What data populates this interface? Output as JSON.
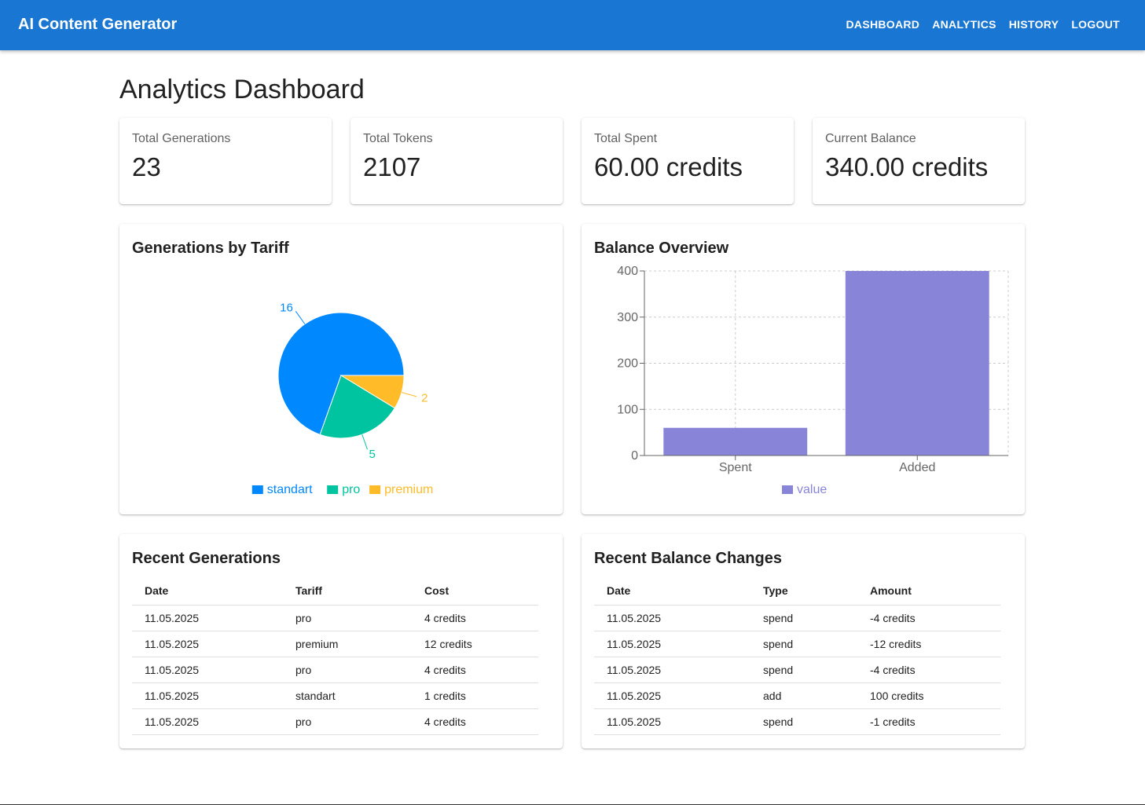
{
  "app": {
    "title": "AI Content Generator",
    "nav": [
      "DASHBOARD",
      "ANALYTICS",
      "HISTORY",
      "LOGOUT"
    ]
  },
  "page": {
    "title": "Analytics Dashboard"
  },
  "stats": [
    {
      "label": "Total Generations",
      "value": "23"
    },
    {
      "label": "Total Tokens",
      "value": "2107"
    },
    {
      "label": "Total Spent",
      "value": "60.00 credits"
    },
    {
      "label": "Current Balance",
      "value": "340.00 credits"
    }
  ],
  "pie_card": {
    "title": "Generations by Tariff"
  },
  "bar_card": {
    "title": "Balance Overview"
  },
  "chart_data": [
    {
      "type": "pie",
      "title": "Generations by Tariff",
      "categories": [
        "standart",
        "pro",
        "premium"
      ],
      "values": [
        16,
        5,
        2
      ],
      "colors": [
        "#0088fe",
        "#00c49f",
        "#ffbb28"
      ],
      "legend": "bottom"
    },
    {
      "type": "bar",
      "title": "Balance Overview",
      "categories": [
        "Spent",
        "Added"
      ],
      "series": [
        {
          "name": "value",
          "values": [
            60,
            400
          ]
        }
      ],
      "ylim": [
        0,
        400
      ],
      "yticks": [
        "0",
        "100",
        "200",
        "300",
        "400"
      ],
      "grid": true,
      "color": "#8884d8",
      "legend": "bottom"
    }
  ],
  "recent_generations": {
    "title": "Recent Generations",
    "columns": [
      "Date",
      "Tariff",
      "Cost"
    ],
    "rows": [
      [
        "11.05.2025",
        "pro",
        "4 credits"
      ],
      [
        "11.05.2025",
        "premium",
        "12 credits"
      ],
      [
        "11.05.2025",
        "pro",
        "4 credits"
      ],
      [
        "11.05.2025",
        "standart",
        "1 credits"
      ],
      [
        "11.05.2025",
        "pro",
        "4 credits"
      ]
    ]
  },
  "recent_balance": {
    "title": "Recent Balance Changes",
    "columns": [
      "Date",
      "Type",
      "Amount"
    ],
    "rows": [
      [
        "11.05.2025",
        "spend",
        "-4 credits"
      ],
      [
        "11.05.2025",
        "spend",
        "-12 credits"
      ],
      [
        "11.05.2025",
        "spend",
        "-4 credits"
      ],
      [
        "11.05.2025",
        "add",
        "100 credits"
      ],
      [
        "11.05.2025",
        "spend",
        "-1 credits"
      ]
    ]
  }
}
